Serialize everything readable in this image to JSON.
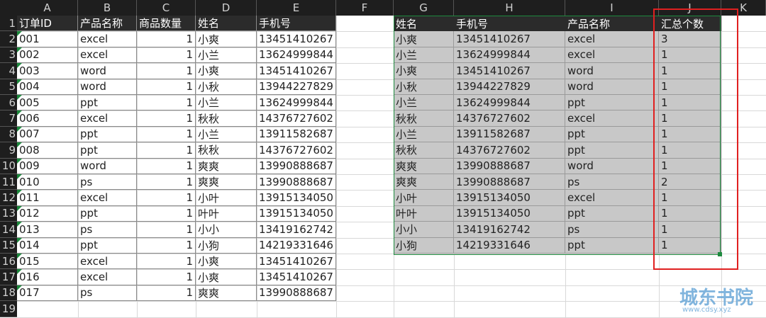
{
  "columns": [
    "A",
    "B",
    "C",
    "D",
    "E",
    "F",
    "G",
    "H",
    "I",
    "J",
    "K"
  ],
  "rows": [
    "1",
    "2",
    "3",
    "4",
    "5",
    "6",
    "7",
    "8",
    "9",
    "10",
    "11",
    "12",
    "13",
    "14",
    "15",
    "16",
    "17",
    "18",
    "19"
  ],
  "left_table": {
    "headers": [
      "订单ID",
      "产品名称",
      "商品数量",
      "姓名",
      "手机号"
    ],
    "rows": [
      [
        "001",
        "excel",
        "1",
        "小爽",
        "13451410267"
      ],
      [
        "002",
        "excel",
        "1",
        "小兰",
        "13624999844"
      ],
      [
        "003",
        "word",
        "1",
        "小爽",
        "13451410267"
      ],
      [
        "004",
        "word",
        "1",
        "小秋",
        "13944227829"
      ],
      [
        "005",
        "ppt",
        "1",
        "小兰",
        "13624999844"
      ],
      [
        "006",
        "excel",
        "1",
        "秋秋",
        "14376727602"
      ],
      [
        "007",
        "ppt",
        "1",
        "小兰",
        "13911582687"
      ],
      [
        "008",
        "ppt",
        "1",
        "秋秋",
        "14376727602"
      ],
      [
        "009",
        "word",
        "1",
        "爽爽",
        "13990888687"
      ],
      [
        "010",
        "ps",
        "1",
        "爽爽",
        "13990888687"
      ],
      [
        "011",
        "excel",
        "1",
        "小叶",
        "13915134050"
      ],
      [
        "012",
        "ppt",
        "1",
        "叶叶",
        "13915134050"
      ],
      [
        "013",
        "ps",
        "1",
        "小小",
        "13419162742"
      ],
      [
        "014",
        "ppt",
        "1",
        "小狗",
        "14219331646"
      ],
      [
        "015",
        "excel",
        "1",
        "小爽",
        "13451410267"
      ],
      [
        "016",
        "excel",
        "1",
        "小爽",
        "13451410267"
      ],
      [
        "017",
        "ps",
        "1",
        "爽爽",
        "13990888687"
      ]
    ]
  },
  "right_table": {
    "headers": [
      "姓名",
      "手机号",
      "产品名称",
      "汇总个数"
    ],
    "rows": [
      [
        "小爽",
        "13451410267",
        "excel",
        "3"
      ],
      [
        "小兰",
        "13624999844",
        "excel",
        "1"
      ],
      [
        "小爽",
        "13451410267",
        "word",
        "1"
      ],
      [
        "小秋",
        "13944227829",
        "word",
        "1"
      ],
      [
        "小兰",
        "13624999844",
        "ppt",
        "1"
      ],
      [
        "秋秋",
        "14376727602",
        "excel",
        "1"
      ],
      [
        "小兰",
        "13911582687",
        "ppt",
        "1"
      ],
      [
        "秋秋",
        "14376727602",
        "ppt",
        "1"
      ],
      [
        "爽爽",
        "13990888687",
        "word",
        "1"
      ],
      [
        "爽爽",
        "13990888687",
        "ps",
        "2"
      ],
      [
        "小叶",
        "13915134050",
        "excel",
        "1"
      ],
      [
        "叶叶",
        "13915134050",
        "ppt",
        "1"
      ],
      [
        "小小",
        "13419162742",
        "ps",
        "1"
      ],
      [
        "小狗",
        "14219331646",
        "ppt",
        "1"
      ]
    ]
  },
  "watermark": {
    "text": "城东书院",
    "url": "www.cdsy.xyz"
  },
  "colors": {
    "selection": "#1e8a3e",
    "highlight_box": "#e02020",
    "header_bg": "#1e1e1e"
  }
}
